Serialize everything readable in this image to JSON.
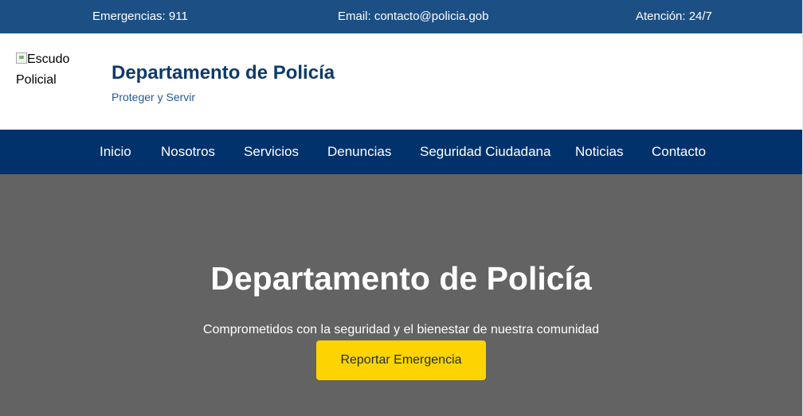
{
  "topbar": {
    "emergency": "Emergencias: 911",
    "email": "Email: contacto@policia.gob",
    "hours": "Atención: 24/7"
  },
  "header": {
    "logo_alt": "Escudo Policial",
    "title": "Departamento de Policía",
    "tagline": "Proteger y Servir"
  },
  "nav": {
    "items": [
      "Inicio",
      "Nosotros",
      "Servicios",
      "Denuncias",
      "Seguridad Ciudadana",
      "Noticias",
      "Contacto"
    ]
  },
  "hero": {
    "title": "Departamento de Policía",
    "subtitle": "Comprometidos con la seguridad y el bienestar de nuestra comunidad",
    "button": "Reportar Emergencia"
  },
  "colors": {
    "topbar": "#1c5085",
    "nav": "#02326b",
    "hero": "#636363",
    "button": "#fdd300",
    "brand_title": "#0e3a6b"
  }
}
